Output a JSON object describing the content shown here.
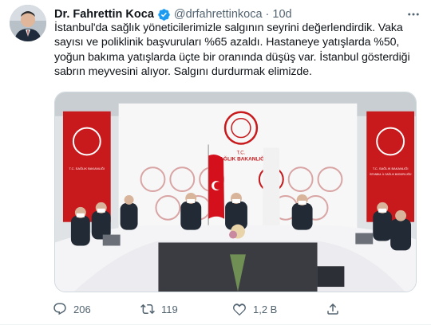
{
  "tweet": {
    "author_name": "Dr. Fahrettin Koca",
    "handle": "@drfahrettinkoca",
    "separator": "·",
    "time": "10d",
    "text": "İstanbul'da sağlık yöneticilerimizle  salgının seyrini değerlendirdik. Vaka sayısı ve poliklinik başvuruları %65 azaldı. Hastaneye yatışlarda %50, yoğun bakıma yatışlarda üçte bir oranında düşüş var. İstanbul gösterdiği sabrın meyvesini alıyor. Salgını durdurmak elimizde.",
    "media_banner_line1": "T.C.",
    "media_banner_line2": "SAĞLIK BAKANLIĞI",
    "media_side_banner_line1": "T.C. SAĞLIK BAKANLIĞI",
    "media_side_banner_line2": "İSTANBUL İL SAĞLIK MÜDÜRLÜĞÜ"
  },
  "actions": {
    "reply_count": "206",
    "retweet_count": "119",
    "like_count": "1,2 B",
    "share_count": ""
  },
  "colors": {
    "verified": "#1d9bf0",
    "muted": "#536471",
    "text": "#0f1419",
    "ministry_red": "#c8191c"
  },
  "icons": [
    "avatar",
    "verified-badge-icon",
    "more-icon",
    "reply-icon",
    "retweet-icon",
    "like-icon",
    "share-icon"
  ]
}
